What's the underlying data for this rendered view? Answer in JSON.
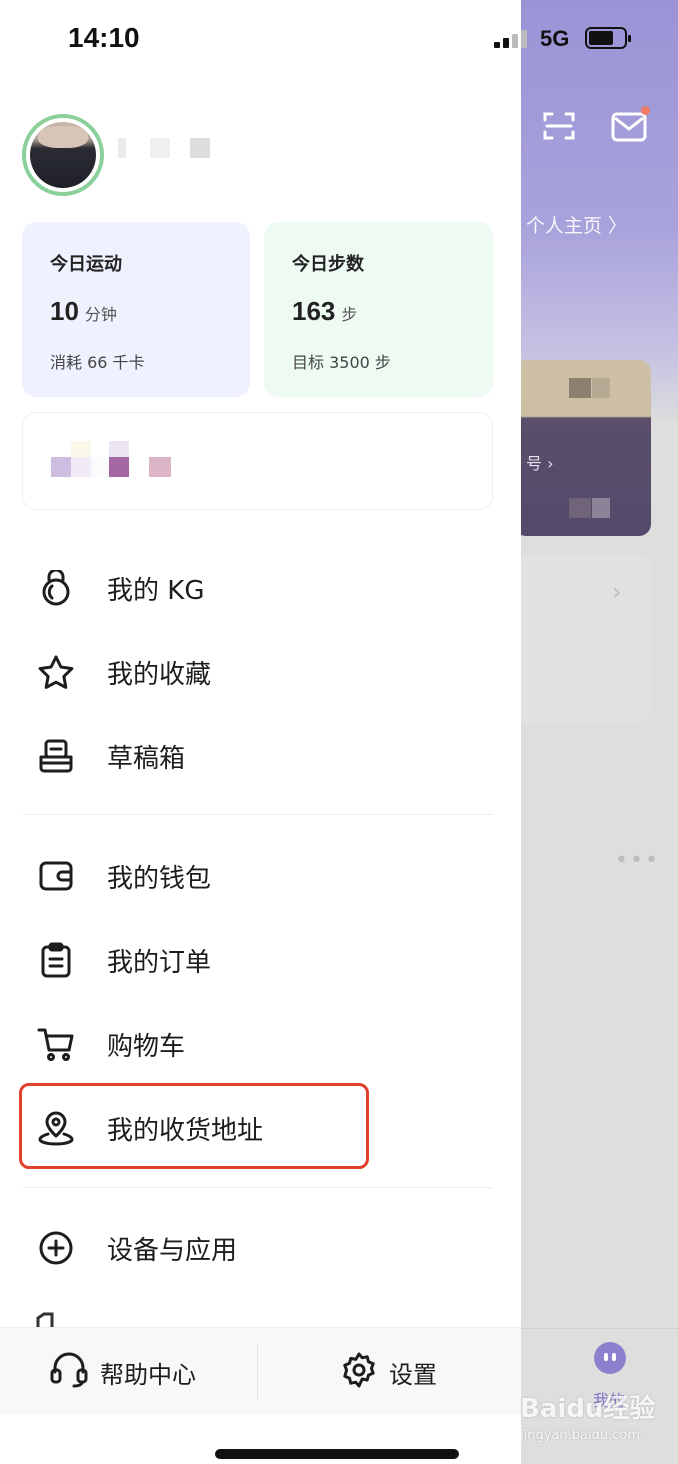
{
  "status_bar": {
    "time": "14:10",
    "network": "5G"
  },
  "profile": {
    "avatar": "avatar",
    "username_hidden": true
  },
  "stats": [
    {
      "title": "今日运动",
      "value": "10",
      "unit": "分钟",
      "sub": "消耗 66 千卡"
    },
    {
      "title": "今日步数",
      "value": "163",
      "unit": "步",
      "sub": "目标 3500 步"
    }
  ],
  "menu_group_1": [
    {
      "icon": "kettlebell-icon",
      "label": "我的 KG"
    },
    {
      "icon": "star-icon",
      "label": "我的收藏"
    },
    {
      "icon": "draft-box-icon",
      "label": "草稿箱"
    }
  ],
  "menu_group_2": [
    {
      "icon": "wallet-icon",
      "label": "我的钱包"
    },
    {
      "icon": "clipboard-icon",
      "label": "我的订单"
    },
    {
      "icon": "cart-icon",
      "label": "购物车"
    },
    {
      "icon": "location-pin-icon",
      "label": "我的收货地址"
    }
  ],
  "menu_group_3": [
    {
      "icon": "plus-circle-icon",
      "label": "设备与应用"
    }
  ],
  "bottom_bar": {
    "help_label": "帮助中心",
    "settings_label": "设置"
  },
  "background_page": {
    "profile_link": "个人主页 〉",
    "tab_label": "我的",
    "watermark": "Baidu经验",
    "watermark_sub": "jingyan.baidu.com"
  },
  "colors": {
    "highlight": "#e2402c",
    "accent_purple": "#8f80cf",
    "ring_green": "#8bd09a"
  }
}
